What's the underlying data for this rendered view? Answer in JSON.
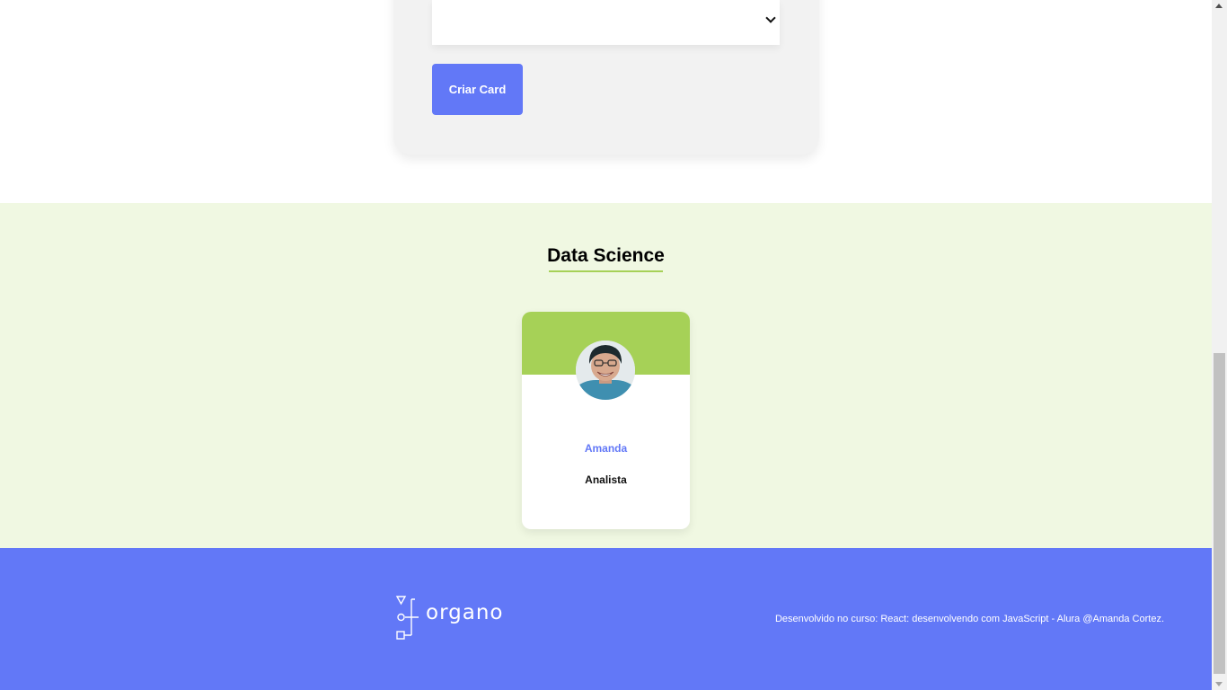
{
  "form": {
    "select_value": "",
    "create_button_label": "Criar Card"
  },
  "team": {
    "title": "Data Science",
    "primary_color": "#a6d157",
    "secondary_color": "#f0f8e2",
    "members": [
      {
        "name": "Amanda",
        "role": "Analista"
      }
    ]
  },
  "footer": {
    "logo_text": "organo",
    "credit": "Desenvolvido no curso: React: desenvolvendo com JavaScript - Alura @Amanda Cortez.",
    "background_color": "#6278f7"
  },
  "colors": {
    "accent": "#6278f7"
  }
}
